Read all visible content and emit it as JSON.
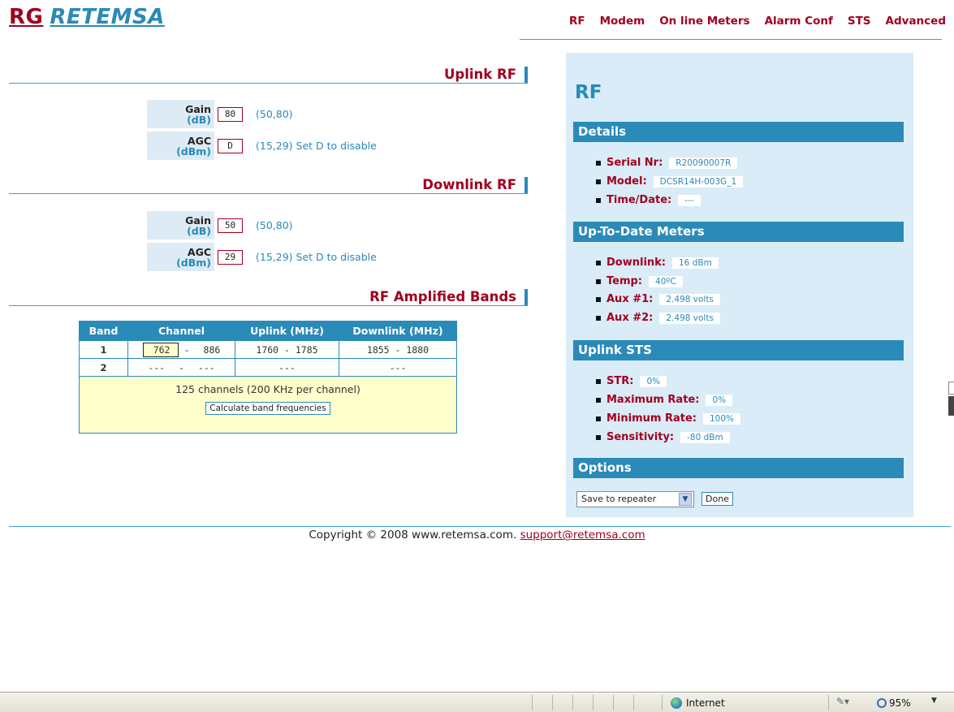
{
  "logo": {
    "rg": "RG",
    "retemsa": "RETEMSA"
  },
  "nav": [
    "RF",
    "Modem",
    "On line Meters",
    "Alarm Conf",
    "STS",
    "Advanced"
  ],
  "uplink": {
    "title": "Uplink RF",
    "gain": {
      "name": "Gain",
      "unit": "(dB)",
      "value": "80",
      "hint": "(50,80)"
    },
    "agc": {
      "name": "AGC",
      "unit": "(dBm)",
      "value": "D",
      "hint": "(15,29) Set D to disable"
    }
  },
  "downlink": {
    "title": "Downlink RF",
    "gain": {
      "name": "Gain",
      "unit": "(dB)",
      "value": "50",
      "hint": "(50,80)"
    },
    "agc": {
      "name": "AGC",
      "unit": "(dBm)",
      "value": "29",
      "hint": "(15,29) Set D to disable"
    }
  },
  "bands": {
    "title": "RF Amplified Bands",
    "headers": [
      "Band",
      "Channel",
      "Uplink (MHz)",
      "Downlink (MHz)"
    ],
    "rows": [
      {
        "band": "1",
        "ch_start": "762",
        "ch_sep": "-",
        "ch_end": "886",
        "uplink": "1760 - 1785",
        "downlink": "1855 - 1880"
      },
      {
        "band": "2",
        "ch_start": "---",
        "ch_sep": "-",
        "ch_end": "---",
        "uplink": "---",
        "downlink": "---"
      }
    ],
    "summary": "125 channels (200 KHz per channel)",
    "calc_button": "Calculate band frequencies"
  },
  "panel": {
    "title": "RF",
    "details": {
      "heading": "Details",
      "serial_label": "Serial Nr:",
      "serial_value": "R20090007R",
      "model_label": "Model:",
      "model_value": "DCSR14H-003G_1",
      "time_label": "Time/Date:",
      "time_value": "---"
    },
    "meters": {
      "heading": "Up-To-Date Meters",
      "downlink_label": "Downlink:",
      "downlink_value": "16 dBm",
      "temp_label": "Temp:",
      "temp_value": "40ºC",
      "aux1_label": "Aux #1:",
      "aux1_value": "2.498 volts",
      "aux2_label": "Aux #2:",
      "aux2_value": "2.498 volts"
    },
    "sts": {
      "heading": "Uplink STS",
      "str_label": "STR:",
      "str_value": "0%",
      "max_label": "Maximum Rate:",
      "max_value": "0%",
      "min_label": "Minimum Rate:",
      "min_value": "100%",
      "sens_label": "Sensitivity:",
      "sens_value": "-80 dBm"
    },
    "options": {
      "heading": "Options",
      "select_value": "Save to repeater",
      "done_button": "Done"
    }
  },
  "footer": {
    "copyright": "Copyright © 2008 www.retemsa.com.",
    "support_link": "support@retemsa.com"
  },
  "statusbar": {
    "zone": "Internet",
    "zoom": "95%"
  },
  "colors": {
    "brand_red": "#a00020",
    "brand_blue": "#2a8ab8",
    "panel_bg": "#d9ecf7"
  }
}
